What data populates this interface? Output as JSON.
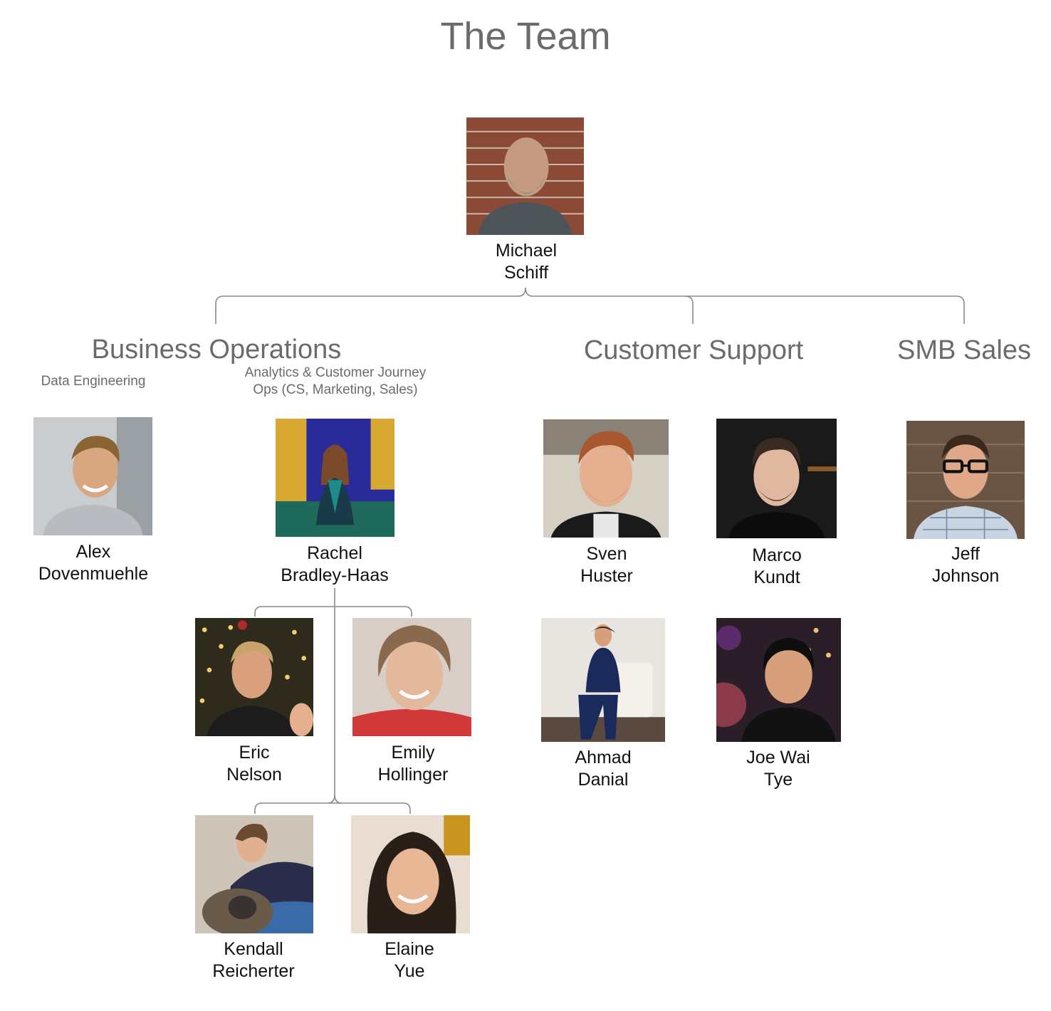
{
  "title": "The Team",
  "ceo": {
    "first": "Michael",
    "last": "Schiff"
  },
  "departments": [
    {
      "name": "Business Operations"
    },
    {
      "name": "Customer Support"
    },
    {
      "name": "SMB Sales"
    }
  ],
  "teams": {
    "data_engineering": "Data Engineering",
    "analytics_line1": "Analytics & Customer Journey",
    "analytics_line2": "Ops (CS, Marketing, Sales)"
  },
  "people": {
    "alex": {
      "first": "Alex",
      "last": "Dovenmuehle"
    },
    "rachel": {
      "first": "Rachel",
      "last": "Bradley-Haas"
    },
    "eric": {
      "first": "Eric",
      "last": "Nelson"
    },
    "emily": {
      "first": "Emily",
      "last": "Hollinger"
    },
    "kendall": {
      "first": "Kendall",
      "last": "Reicherter"
    },
    "elaine": {
      "first": "Elaine",
      "last": "Yue"
    },
    "sven": {
      "first": "Sven",
      "last": "Huster"
    },
    "marco": {
      "first": "Marco",
      "last": "Kundt"
    },
    "ahmad": {
      "first": "Ahmad",
      "last": "Danial"
    },
    "joe": {
      "first": "Joe Wai",
      "last": "Tye"
    },
    "jeff": {
      "first": "Jeff",
      "last": "Johnson"
    }
  }
}
